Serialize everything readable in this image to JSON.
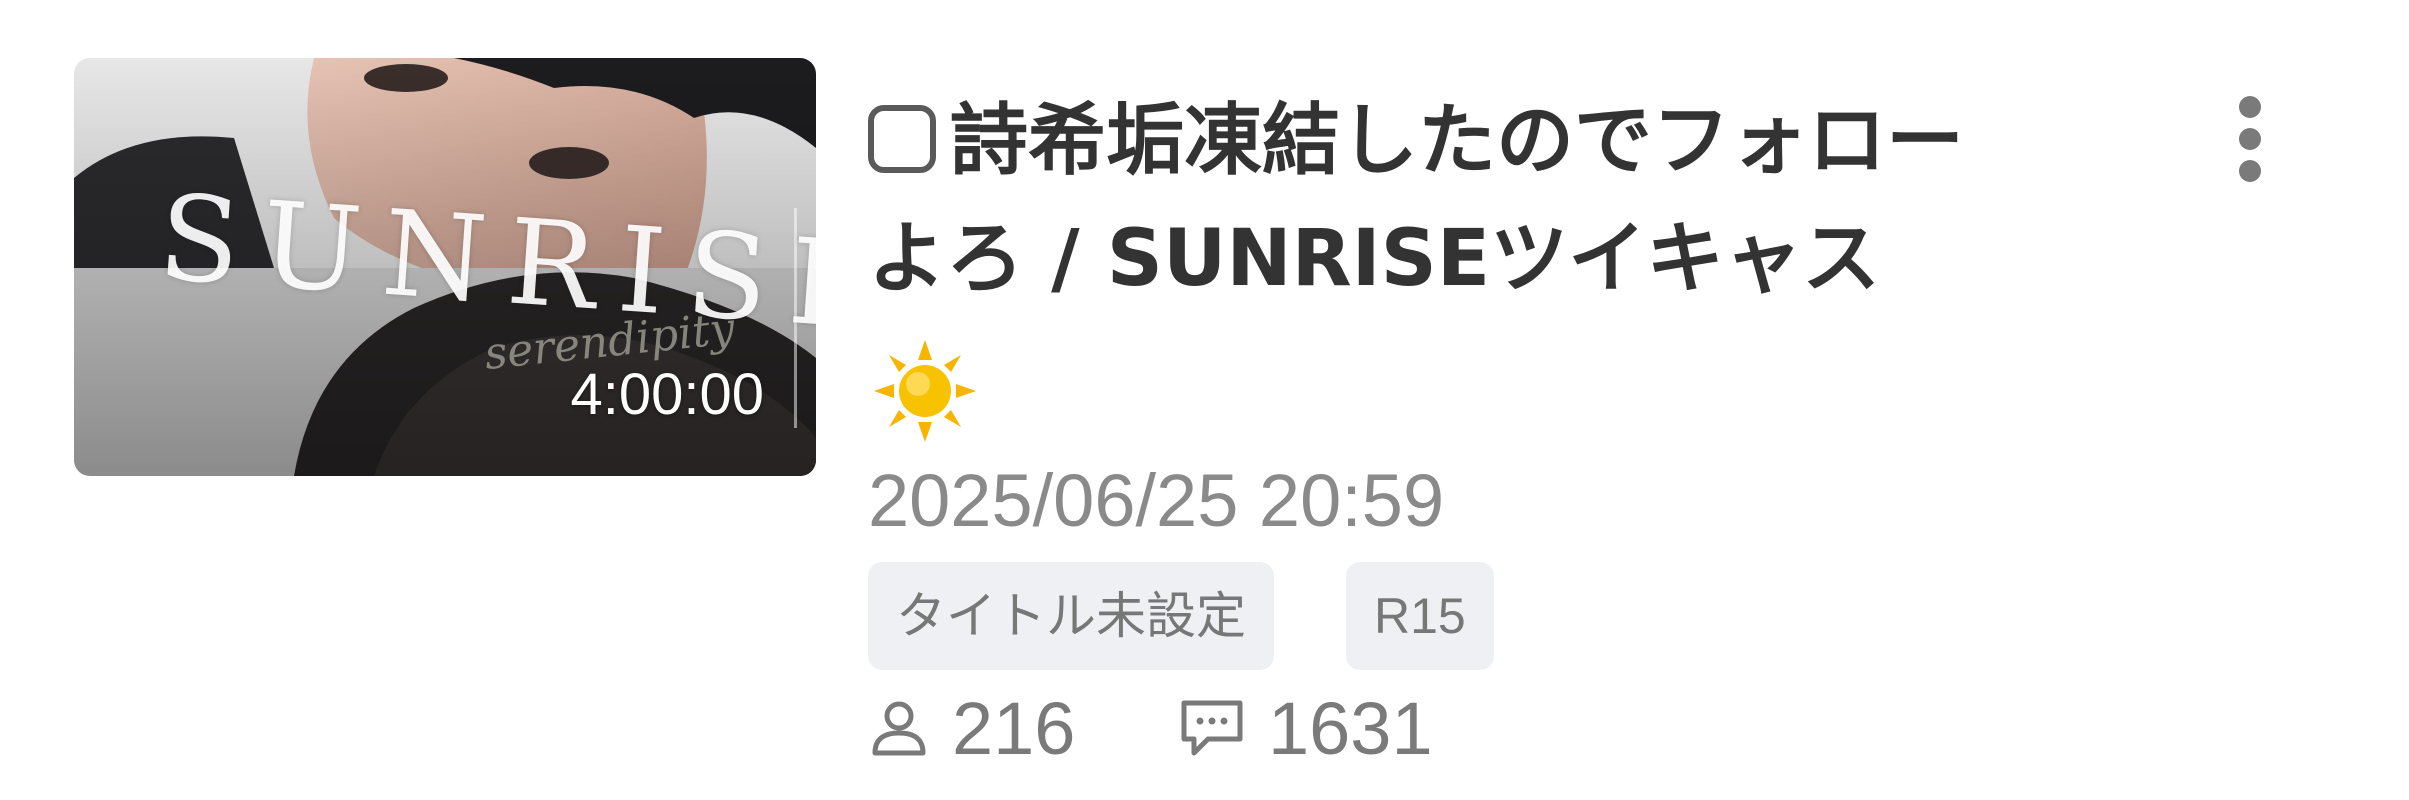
{
  "thumbnail": {
    "duration": "4:00:00",
    "logo_text": "SUNRISE",
    "script_text": "serendipity"
  },
  "title": {
    "line1": "詩希垢凍結したのでフォロー",
    "line2": "よろ / SUNRISEツイキャス"
  },
  "subtitle_emoji": "sun",
  "datetime": "2025/06/25 20:59",
  "tags": [
    "タイトル未設定",
    "R15"
  ],
  "stats": {
    "viewers": "216",
    "comments": "1631"
  },
  "icons": {
    "title_prefix": "square-outline-icon",
    "menu": "more-vertical-icon",
    "viewers": "person-icon",
    "comments": "comment-icon",
    "emoji": "sun-icon"
  },
  "colors": {
    "title": "#333333",
    "meta": "#8a8a8a",
    "tag_bg": "#eef0f3",
    "sun": "#f7b500"
  }
}
